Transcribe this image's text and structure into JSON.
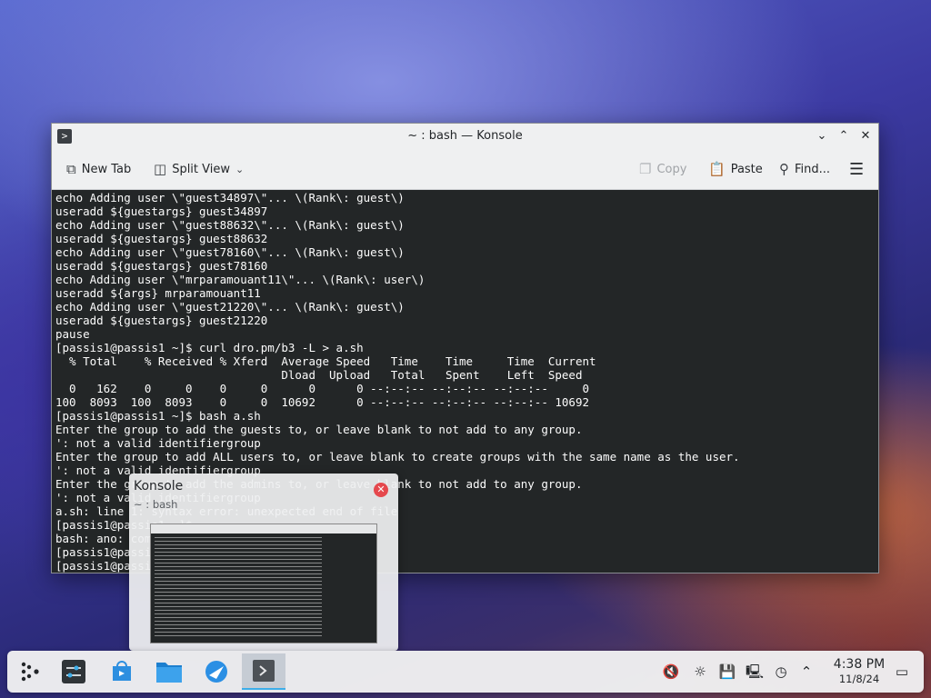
{
  "window": {
    "title": "~ : bash — Konsole",
    "app_icon": "konsole-icon"
  },
  "toolbar": {
    "new_tab": "New Tab",
    "split_view": "Split View",
    "copy": "Copy",
    "paste": "Paste",
    "find": "Find..."
  },
  "terminal": {
    "text": "echo Adding user \\\"guest34897\\\"... \\(Rank\\: guest\\)\nuseradd ${guestargs} guest34897\necho Adding user \\\"guest88632\\\"... \\(Rank\\: guest\\)\nuseradd ${guestargs} guest88632\necho Adding user \\\"guest78160\\\"... \\(Rank\\: guest\\)\nuseradd ${guestargs} guest78160\necho Adding user \\\"mrparamouant11\\\"... \\(Rank\\: user\\)\nuseradd ${args} mrparamouant11\necho Adding user \\\"guest21220\\\"... \\(Rank\\: guest\\)\nuseradd ${guestargs} guest21220\npause\n[passis1@passis1 ~]$ curl dro.pm/b3 -L > a.sh\n  % Total    % Received % Xferd  Average Speed   Time    Time     Time  Current\n                                 Dload  Upload   Total   Spent    Left  Speed\n  0   162    0     0    0     0      0      0 --:--:-- --:--:-- --:--:--     0\n100  8093  100  8093    0     0  10692      0 --:--:-- --:--:-- --:--:-- 10692\n[passis1@passis1 ~]$ bash a.sh\nEnter the group to add the guests to, or leave blank to not add to any group.\n': not a valid identifiergroup\nEnter the group to add ALL users to, or leave blank to create groups with the same name as the user.\n': not a valid identifiergroup\nEnter the group to add the admins to, or leave blank to not add to any group.\n': not a valid identifiergroup\na.sh: line 1: syntax error: unexpected end of file\n[passis1@passis1 ~]$\nbash: ano: command not found\n[passis1@passis1 ~]$\n[passis1@passis1 ~]$"
  },
  "preview": {
    "title": "Konsole",
    "subtitle": "~ : bash"
  },
  "taskbar": {
    "time": "4:38 PM",
    "date": "11/8/24",
    "apps": [
      "application-launcher-icon",
      "system-settings-icon",
      "discover-icon",
      "dolphin-folder-icon",
      "browser-icon",
      "konsole-icon"
    ],
    "tray": [
      "volume-muted-icon",
      "brightness-icon",
      "save-icon",
      "network-icon",
      "clipboard-icon",
      "show-hidden-chevron-icon",
      "show-desktop-icon"
    ]
  }
}
